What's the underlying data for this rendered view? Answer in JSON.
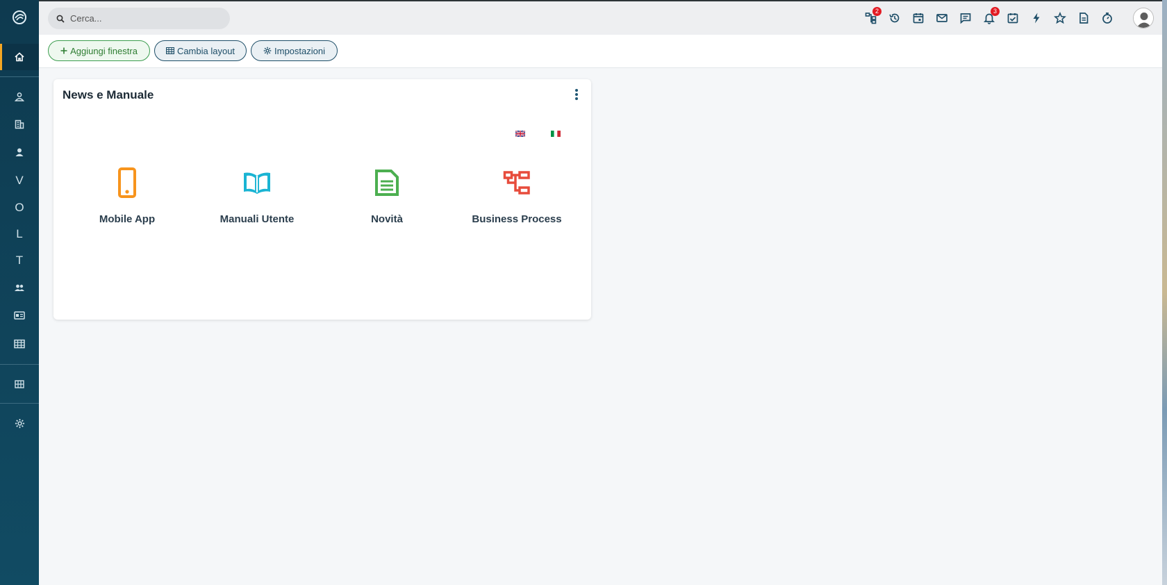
{
  "search": {
    "placeholder": "Cerca..."
  },
  "topbar": {
    "badges": {
      "process": "2",
      "notifications": "3"
    }
  },
  "toolbar": {
    "add_window_label": "Aggiungi finestra",
    "change_layout_label": "Cambia layout",
    "settings_label": "Impostazioni"
  },
  "sidebar": {
    "letters": [
      "V",
      "O",
      "L",
      "T"
    ]
  },
  "widget": {
    "title": "News e Manuale",
    "items": [
      {
        "label": "Mobile App",
        "icon": "mobile-icon",
        "color": "#f7941d"
      },
      {
        "label": "Manuali Utente",
        "icon": "book-icon",
        "color": "#1ab4d3"
      },
      {
        "label": "Novità",
        "icon": "document-icon",
        "color": "#4caf50"
      },
      {
        "label": "Business Process",
        "icon": "process-icon",
        "color": "#e74c3c"
      }
    ]
  },
  "colors": {
    "sidebar": "#0e3a4f",
    "accent": "#f5a623",
    "badge": "#e31b23"
  }
}
